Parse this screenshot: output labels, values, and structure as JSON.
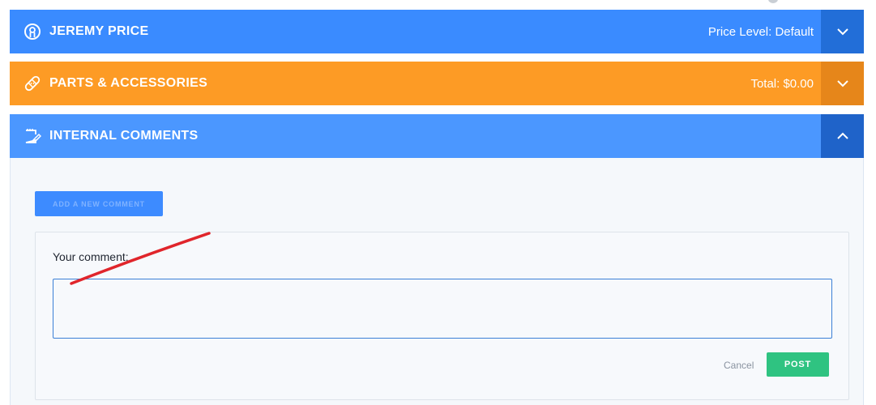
{
  "customer_panel": {
    "title": "JEREMY PRICE",
    "summary": "Price Level: Default",
    "icon": "user-circle-icon",
    "color": "#3a8bff"
  },
  "parts_panel": {
    "title": "PARTS & ACCESSORIES",
    "summary": "Total: $0.00",
    "icon": "bandage-icon",
    "color": "#fd9b25"
  },
  "comments_panel": {
    "title": "INTERNAL COMMENTS",
    "icon": "notepad-pen-icon",
    "color": "#4b97ff",
    "add_button_label": "ADD A NEW COMMENT",
    "comment_label": "Your comment:",
    "comment_value": "",
    "cancel_label": "Cancel",
    "post_label": "POST",
    "post_color": "#2fc381"
  },
  "annotation": {
    "type": "red-line",
    "color": "#e0252b"
  }
}
